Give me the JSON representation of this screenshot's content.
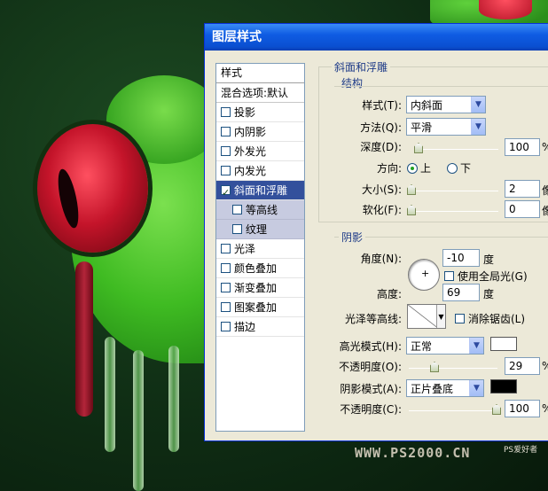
{
  "dialog": {
    "title": "图层样式"
  },
  "style_list": {
    "header": "样式",
    "blend_options": "混合选项:默认",
    "items": [
      {
        "label": "投影",
        "checked": false
      },
      {
        "label": "内阴影",
        "checked": false
      },
      {
        "label": "外发光",
        "checked": false
      },
      {
        "label": "内发光",
        "checked": false
      },
      {
        "label": "斜面和浮雕",
        "checked": true,
        "selected": true
      },
      {
        "label": "等高线",
        "checked": false,
        "sub": true
      },
      {
        "label": "纹理",
        "checked": false,
        "sub": true
      },
      {
        "label": "光泽",
        "checked": false
      },
      {
        "label": "颜色叠加",
        "checked": false
      },
      {
        "label": "渐变叠加",
        "checked": false
      },
      {
        "label": "图案叠加",
        "checked": false
      },
      {
        "label": "描边",
        "checked": false
      }
    ]
  },
  "bevel": {
    "section_title": "斜面和浮雕",
    "structure": {
      "title": "结构",
      "style_label": "样式(T):",
      "style_value": "内斜面",
      "technique_label": "方法(Q):",
      "technique_value": "平滑",
      "depth_label": "深度(D):",
      "depth_value": "100",
      "depth_unit": "%",
      "direction_label": "方向:",
      "direction_up": "上",
      "direction_down": "下",
      "direction_selected": "上",
      "size_label": "大小(S):",
      "size_value": "2",
      "size_unit": "像",
      "soften_label": "软化(F):",
      "soften_value": "0",
      "soften_unit": "像"
    },
    "shading": {
      "title": "阴影",
      "angle_label": "角度(N):",
      "angle_value": "-10",
      "angle_unit": "度",
      "global_light_label": "使用全局光(G)",
      "altitude_label": "高度:",
      "altitude_value": "69",
      "altitude_unit": "度",
      "gloss_contour_label": "光泽等高线:",
      "antialias_label": "消除锯齿(L)",
      "highlight_mode_label": "高光模式(H):",
      "highlight_mode_value": "正常",
      "highlight_color": "#ffffff",
      "highlight_opacity_label": "不透明度(O):",
      "highlight_opacity_value": "29",
      "shadow_mode_label": "阴影模式(A):",
      "shadow_mode_value": "正片叠底",
      "shadow_color": "#000000",
      "shadow_opacity_label": "不透明度(C):",
      "shadow_opacity_value": "100",
      "percent": "%"
    }
  },
  "watermark": {
    "text": "WWW.PS2000.CN",
    "site": "PS爱好者"
  }
}
